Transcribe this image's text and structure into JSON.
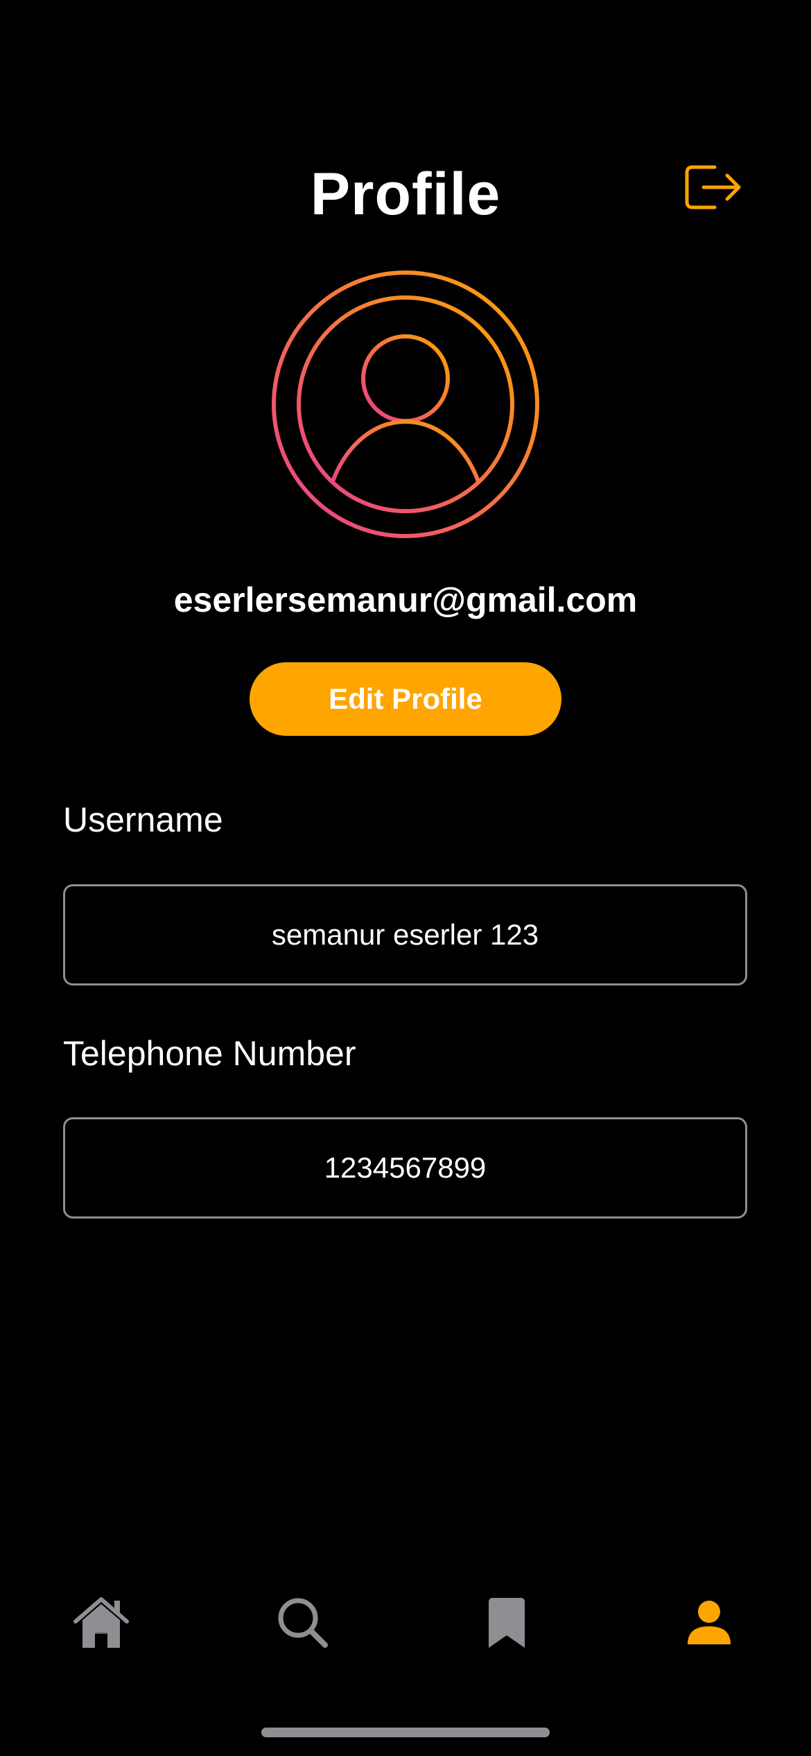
{
  "header": {
    "title": "Profile",
    "logout_icon": "logout-icon"
  },
  "profile": {
    "avatar_icon": "person-circle-icon",
    "email": "eserlersemanur@gmail.com",
    "edit_button_label": "Edit Profile"
  },
  "fields": {
    "username": {
      "label": "Username",
      "value": "semanur eserler 123"
    },
    "telephone": {
      "label": "Telephone Number",
      "value": "1234567899"
    }
  },
  "tab_bar": {
    "items": [
      {
        "icon": "home-icon",
        "active": false
      },
      {
        "icon": "search-icon",
        "active": false
      },
      {
        "icon": "bookmark-icon",
        "active": false
      },
      {
        "icon": "profile-icon",
        "active": true
      }
    ]
  },
  "colors": {
    "accent": "#ffa500",
    "background": "#000000",
    "inactive_icon": "#8e8e93",
    "gradient_start": "#ffa500",
    "gradient_end": "#e83e8c"
  }
}
